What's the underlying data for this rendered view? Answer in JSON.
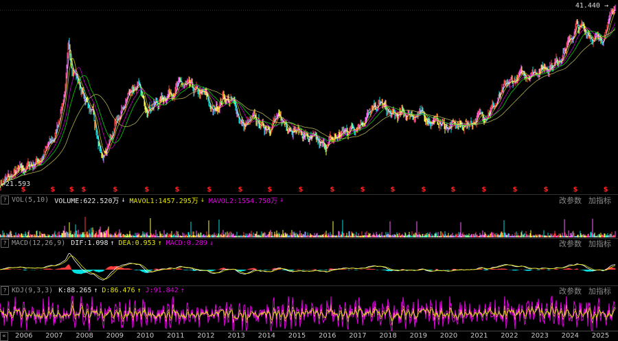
{
  "chart_data": {
    "type": "candlestick",
    "price_high_label": "41.440",
    "price_low_label": "21.593",
    "price_range": [
      21.593,
      41.44
    ],
    "year_range": [
      2005.5,
      2025.82
    ],
    "close_anchors": [
      [
        2005.5,
        21.6
      ],
      [
        2006.18,
        23.0
      ],
      [
        2006.86,
        24.5
      ],
      [
        2007.31,
        26.8
      ],
      [
        2007.65,
        32.2
      ],
      [
        2007.76,
        36.8
      ],
      [
        2007.88,
        34.9
      ],
      [
        2008.1,
        32.9
      ],
      [
        2008.33,
        30.6
      ],
      [
        2008.56,
        29.9
      ],
      [
        2008.85,
        23.7
      ],
      [
        2009.12,
        26.4
      ],
      [
        2009.46,
        29.1
      ],
      [
        2009.8,
        32.2
      ],
      [
        2010.03,
        32.6
      ],
      [
        2010.25,
        30.3
      ],
      [
        2010.71,
        30.6
      ],
      [
        2011.05,
        31.8
      ],
      [
        2011.5,
        32.6
      ],
      [
        2011.95,
        31.8
      ],
      [
        2012.29,
        31.4
      ],
      [
        2012.52,
        29.5
      ],
      [
        2012.86,
        31.4
      ],
      [
        2013.19,
        30.6
      ],
      [
        2013.53,
        27.9
      ],
      [
        2013.87,
        28.7
      ],
      [
        2014.21,
        27.9
      ],
      [
        2014.55,
        28.7
      ],
      [
        2015.0,
        28.3
      ],
      [
        2015.46,
        27.2
      ],
      [
        2016.14,
        25.7
      ],
      [
        2016.59,
        26.8
      ],
      [
        2017.27,
        28.3
      ],
      [
        2017.72,
        29.5
      ],
      [
        2018.06,
        30.6
      ],
      [
        2018.4,
        29.1
      ],
      [
        2019.08,
        29.5
      ],
      [
        2019.76,
        28.7
      ],
      [
        2020.32,
        27.9
      ],
      [
        2020.89,
        28.3
      ],
      [
        2021.34,
        29.1
      ],
      [
        2021.79,
        30.3
      ],
      [
        2022.24,
        32.6
      ],
      [
        2022.69,
        33.7
      ],
      [
        2023.38,
        34.5
      ],
      [
        2023.83,
        35.2
      ],
      [
        2024.28,
        37.5
      ],
      [
        2024.5,
        39.1
      ],
      [
        2024.84,
        38.7
      ],
      [
        2025.19,
        37.5
      ],
      [
        2025.41,
        38.3
      ],
      [
        2025.64,
        40.6
      ],
      [
        2025.8,
        41.44
      ]
    ],
    "dividend_marker": "$",
    "dividend_years": [
      2006.27,
      2007.24,
      2007.86,
      2008.26,
      2009.3,
      2010.34,
      2011.34,
      2012.4,
      2013.42,
      2014.39,
      2015.41,
      2016.45,
      2017.45,
      2018.44,
      2019.46,
      2020.43,
      2021.45,
      2022.47,
      2023.49,
      2024.46,
      2025.46
    ],
    "x_ticks": [
      "2006",
      "2007",
      "2008",
      "2009",
      "2010",
      "2011",
      "2012",
      "2013",
      "2014",
      "2015",
      "2016",
      "2017",
      "2018",
      "2019",
      "2020",
      "2021",
      "2022",
      "2023",
      "2024",
      "2025"
    ],
    "colors": {
      "up": "#ff3c3c",
      "down": "#00e0e0",
      "ma1": "#ffffff",
      "ma2": "#e6e600",
      "ma3": "#e000e0",
      "ma4": "#00ff00",
      "ma5": "#d0d060",
      "kdj_k": "#ffffff",
      "kdj_d": "#e6e600",
      "kdj_j": "#e000e0"
    }
  },
  "vol": {
    "name": "VOL(5,10)",
    "volume": "VOLUME:622.520万",
    "mavol1": "MAVOL1:1457.295万",
    "mavol2": "MAVOL2:1554.750万",
    "a1": "↓",
    "a2": "↓",
    "a3": "↓"
  },
  "macd": {
    "name": "MACD(12,26,9)",
    "dif": "DIF:1.098",
    "dea": "DEA:0.953",
    "macd": "MACD:0.289",
    "a1": "↑",
    "a2": "↑",
    "a3": "↓"
  },
  "kdj": {
    "name": "KDJ(9,3,3)",
    "k": "K:88.265",
    "d": "D:86.476",
    "j": "J:91.842",
    "a1": "↑",
    "a2": "↑",
    "a3": "↑"
  },
  "buttons": {
    "help": "?",
    "modify": "改参数",
    "add": "加指标",
    "nav": "«"
  }
}
